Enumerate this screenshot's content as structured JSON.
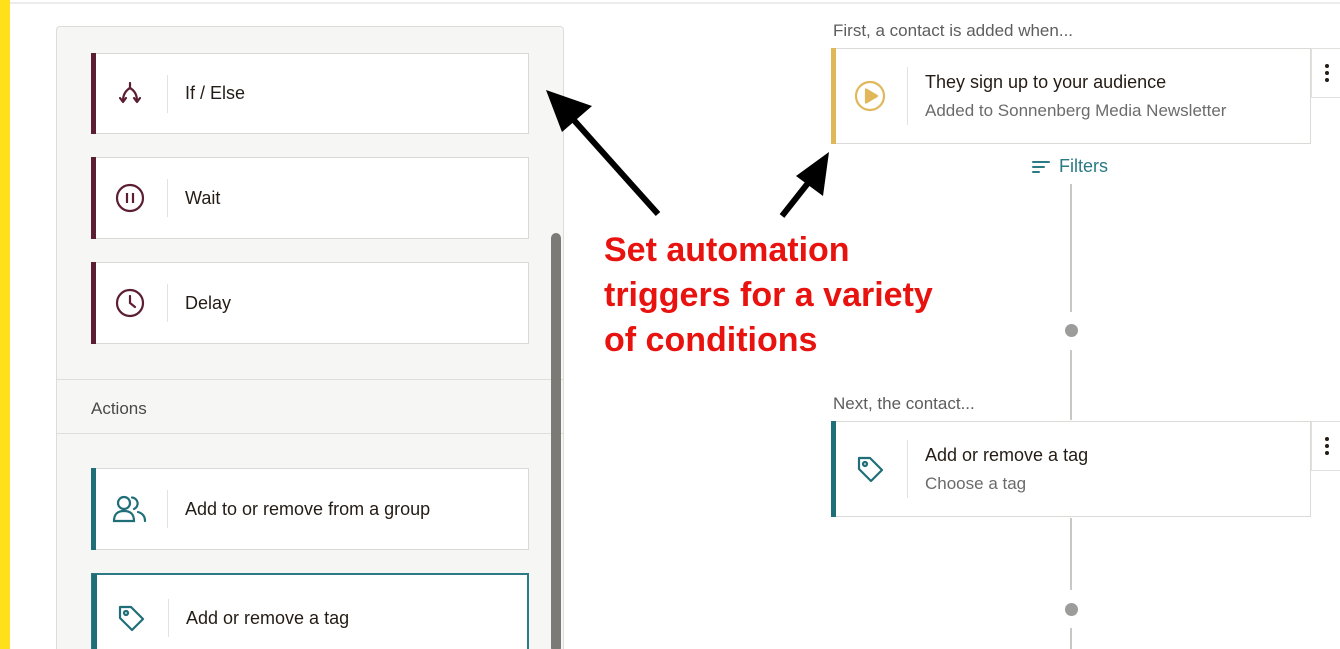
{
  "colors": {
    "brand_yellow": "#ffe01b",
    "maroon_accent": "#5b1e34",
    "teal_accent": "#1f6e78",
    "gold_accent": "#e0b85a",
    "annotation_red": "#e8130f"
  },
  "sidebar": {
    "flow_items": [
      {
        "label": "If / Else",
        "icon": "branch-icon"
      },
      {
        "label": "Wait",
        "icon": "pause-circle-icon"
      },
      {
        "label": "Delay",
        "icon": "clock-icon"
      }
    ],
    "actions_heading": "Actions",
    "action_items": [
      {
        "label": "Add to or remove from a group",
        "icon": "group-icon"
      },
      {
        "label": "Add or remove a tag",
        "icon": "tag-icon"
      }
    ]
  },
  "flow": {
    "trigger_caption": "First, a contact is added when...",
    "trigger": {
      "title": "They sign up to your audience",
      "subtitle": "Added to Sonnenberg Media Newsletter",
      "icon": "play-circle-icon"
    },
    "filters_label": "Filters",
    "next_caption": "Next, the contact...",
    "action": {
      "title": "Add or remove a tag",
      "subtitle": "Choose a tag",
      "icon": "tag-icon"
    }
  },
  "annotation": {
    "line1": "Set automation",
    "line2": "triggers for a variety",
    "line3": "of conditions"
  }
}
